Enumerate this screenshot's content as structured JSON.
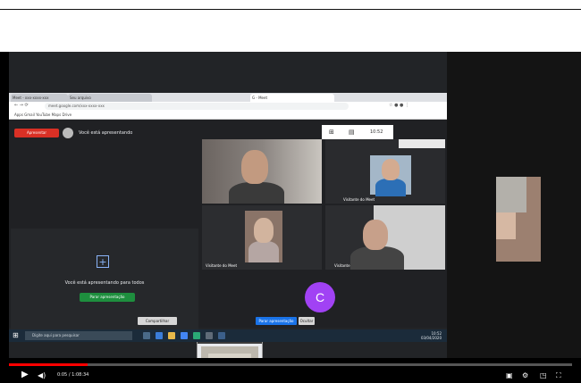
{
  "browser": {
    "tabs": [
      "Meet - xxx-xxxx-xxx",
      "Seu arquivo",
      "G - Meet"
    ],
    "url": "meet.google.com/xxx-xxxx-xxx",
    "bookmarks": "Apps  Gmail  YouTube  Maps  Drive"
  },
  "meet": {
    "present_button": "Apresentar",
    "presenting_label": "Você está apresentando",
    "presentation_title": "Você está apresentando para todos",
    "stop_button": "Parar apresentação",
    "time": "10:52",
    "participants": [
      {
        "name": "",
        "shirt": "#3a3a3a"
      },
      {
        "name": "Visitante do Meet",
        "shirt": "#2c6fb6"
      },
      {
        "name": "Visitante do Meet",
        "shirt": "#b5a6a3"
      },
      {
        "name": "Visitante",
        "shirt": "#444"
      }
    ],
    "avatar_letter": "C",
    "popup_title": "Meet - xxx-xxxx-xxx",
    "chip_left": "Compartilhar",
    "chip_active": "Parar apresentação",
    "chip_end": "Ocultar"
  },
  "taskbar": {
    "search_placeholder": "Digite aqui para pesquisar",
    "time": "10:52",
    "date": "03/04/2020"
  },
  "player": {
    "time_display": "0:05 / 1:08:34",
    "progress_fraction": 0.14
  }
}
